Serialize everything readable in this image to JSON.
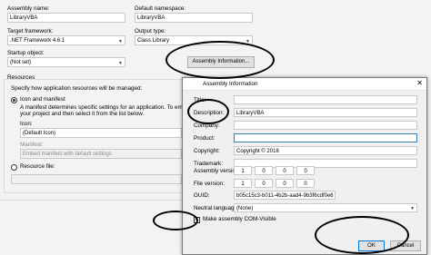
{
  "app": {
    "assembly_name_label": "Assembly name:",
    "assembly_name_value": "LibraryVBA",
    "default_namespace_label": "Default namespace:",
    "default_namespace_value": "LibraryVBA",
    "target_framework_label": "Target framework:",
    "target_framework_value": ".NET Framework 4.6.1",
    "output_type_label": "Output type:",
    "output_type_value": "Class Library",
    "startup_object_label": "Startup object:",
    "startup_object_value": "(Not set)",
    "assembly_information_button": "Assembly Information...",
    "resources": {
      "group_label": "Resources",
      "specify_text": "Specify how application resources will be managed:",
      "icon_manifest_label": "Icon and manifest",
      "icon_manifest_desc_1": "A manifest determines specific settings for an application. To embed a custo",
      "icon_manifest_desc_2": "your project and then select it from the list below.",
      "icon_label": "Icon:",
      "icon_value": "(Default Icon)",
      "manifest_label": "Manifest:",
      "manifest_value": "Embed manifest with default settings",
      "resource_file_label": "Resource file:"
    }
  },
  "dialog": {
    "title": "Assembly Information",
    "fields": {
      "title_label": "Title:",
      "title_value": "",
      "description_label": "Description:",
      "description_value": "LibraryVBA",
      "company_label": "Company:",
      "company_value": "",
      "product_label": "Product:",
      "product_value": "",
      "copyright_label": "Copyright:",
      "copyright_value": "Copyright ©  2016",
      "trademark_label": "Trademark:",
      "trademark_value": "",
      "assembly_version_label": "Assembly version:",
      "assembly_version": [
        "1",
        "0",
        "0",
        "0"
      ],
      "file_version_label": "File version:",
      "file_version": [
        "1",
        "0",
        "0",
        "0"
      ],
      "guid_label": "GUID:",
      "guid_value": "b05c15c3-b011-4b2b-aad4-9b3f6cdf0e6",
      "neutral_language_label": "Neutral language:",
      "neutral_language_value": "(None)",
      "com_visible_label": "Make assembly COM-Visible",
      "com_visible_checked": "✓"
    },
    "ok_button": "OK",
    "cancel_button": "Cancel"
  }
}
